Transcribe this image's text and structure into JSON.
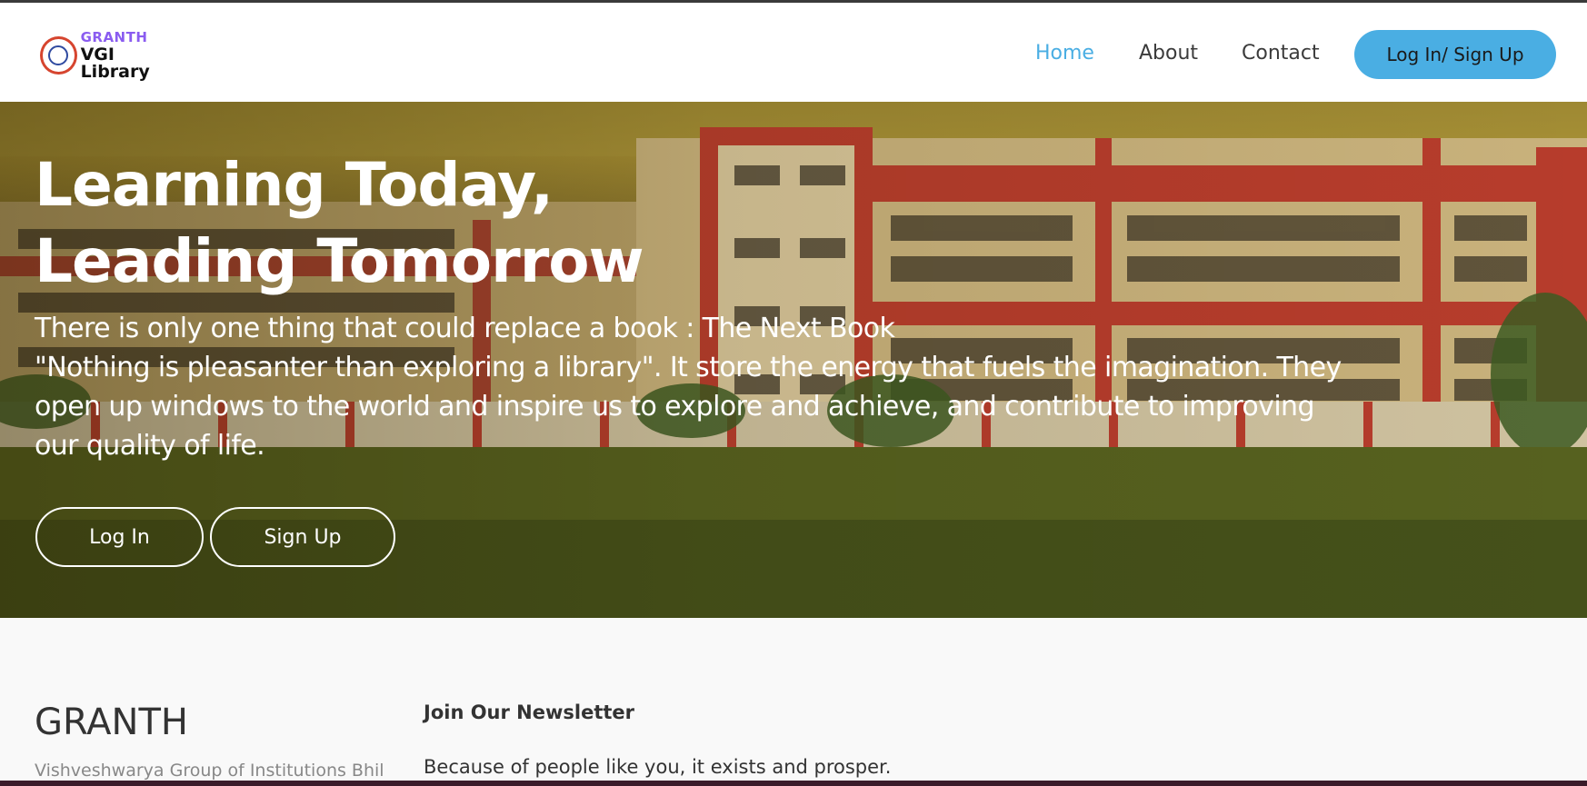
{
  "header": {
    "logo": {
      "line1": "GRANTH",
      "line2": "VGI Library"
    },
    "nav": [
      {
        "label": "Home",
        "active": true
      },
      {
        "label": "About",
        "active": false
      },
      {
        "label": "Contact",
        "active": false
      }
    ],
    "auth_button": "Log In/ Sign Up"
  },
  "hero": {
    "title_line1": "Learning Today,",
    "title_line2": "Leading Tomorrow",
    "text_lines": [
      "There is only one thing that could replace a book : The Next Book",
      "\"Nothing is pleasanter than exploring a library\". It store the energy that fuels the imagination. They",
      "open up windows to the world and inspire us to explore and achieve, and contribute to improving",
      "our quality of life."
    ],
    "login_button": "Log In",
    "signup_button": "Sign Up"
  },
  "footer": {
    "brand": "GRANTH",
    "brand_subtitle": "Vishveshwarya Group of Institutions Bhil",
    "newsletter_title": "Join Our Newsletter",
    "newsletter_text": "Because of people like you, it exists and prosper."
  },
  "colors": {
    "accent": "#4aaee3",
    "nav_text": "#3b3b3b",
    "hero_text": "#ffffff",
    "footer_bg": "#f9f9f9"
  }
}
